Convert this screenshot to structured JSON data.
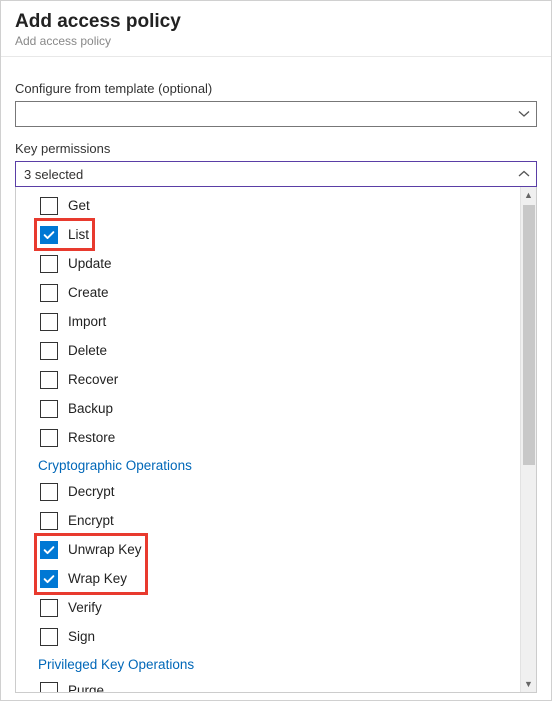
{
  "header": {
    "title": "Add access policy",
    "subtitle": "Add access policy"
  },
  "template_field": {
    "label": "Configure from template (optional)",
    "value": ""
  },
  "key_permissions": {
    "label": "Key permissions",
    "summary": "3 selected",
    "groups": [
      {
        "id": "mgmt",
        "options": [
          {
            "id": "get",
            "label": "Get",
            "checked": false
          },
          {
            "id": "list",
            "label": "List",
            "checked": true
          },
          {
            "id": "update",
            "label": "Update",
            "checked": false
          },
          {
            "id": "create",
            "label": "Create",
            "checked": false
          },
          {
            "id": "import",
            "label": "Import",
            "checked": false
          },
          {
            "id": "delete",
            "label": "Delete",
            "checked": false
          },
          {
            "id": "recover",
            "label": "Recover",
            "checked": false
          },
          {
            "id": "backup",
            "label": "Backup",
            "checked": false
          },
          {
            "id": "restore",
            "label": "Restore",
            "checked": false
          }
        ]
      },
      {
        "id": "crypto",
        "title": "Cryptographic Operations",
        "options": [
          {
            "id": "decrypt",
            "label": "Decrypt",
            "checked": false
          },
          {
            "id": "encrypt",
            "label": "Encrypt",
            "checked": false
          },
          {
            "id": "unwrapkey",
            "label": "Unwrap Key",
            "checked": true
          },
          {
            "id": "wrapkey",
            "label": "Wrap Key",
            "checked": true
          },
          {
            "id": "verify",
            "label": "Verify",
            "checked": false
          },
          {
            "id": "sign",
            "label": "Sign",
            "checked": false
          }
        ]
      },
      {
        "id": "priv",
        "title": "Privileged Key Operations",
        "options": [
          {
            "id": "purge",
            "label": "Purge",
            "checked": false
          }
        ]
      }
    ]
  },
  "highlights": [
    {
      "option_id": "list"
    },
    {
      "option_ids": [
        "unwrapkey",
        "wrapkey"
      ]
    }
  ]
}
